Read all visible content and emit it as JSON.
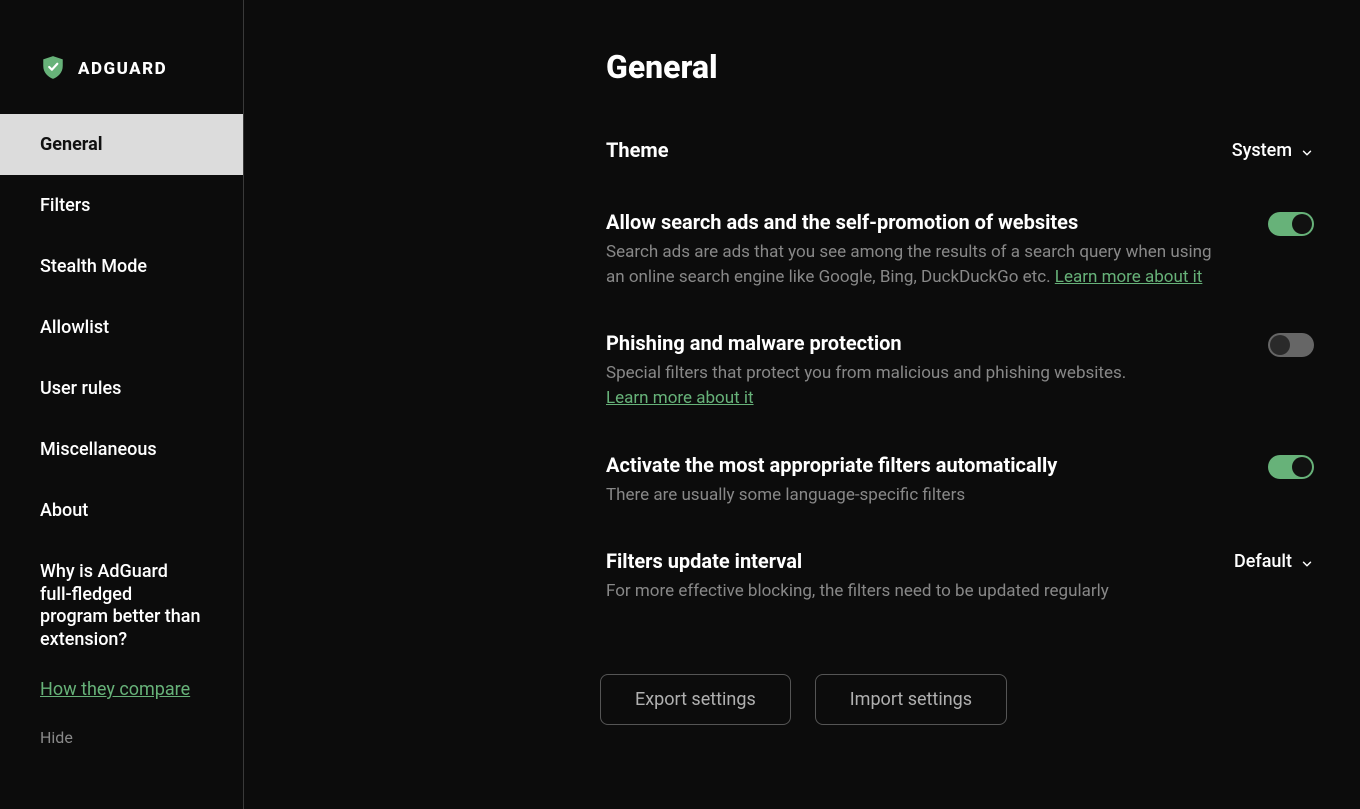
{
  "brand": {
    "name": "ADGUARD"
  },
  "sidebar": {
    "items": [
      {
        "label": "General",
        "active": true
      },
      {
        "label": "Filters"
      },
      {
        "label": "Stealth Mode"
      },
      {
        "label": "Allowlist"
      },
      {
        "label": "User rules"
      },
      {
        "label": "Miscellaneous"
      },
      {
        "label": "About"
      }
    ],
    "promo": {
      "title": "Why is AdGuard full-fledged program better than extension?",
      "link": "How they compare",
      "hide": "Hide"
    }
  },
  "page": {
    "title": "General",
    "theme": {
      "label": "Theme",
      "value": "System"
    },
    "search_ads": {
      "title": "Allow search ads and the self-promotion of websites",
      "desc": "Search ads are ads that you see among the results of a search query when using an online search engine like Google, Bing, DuckDuckGo etc. ",
      "learn": "Learn more about it",
      "on": true
    },
    "phishing": {
      "title": "Phishing and malware protection",
      "desc": "Special filters that protect you from malicious and phishing websites.",
      "learn": "Learn more about it",
      "on": false
    },
    "autofilters": {
      "title": "Activate the most appropriate filters automatically",
      "desc": "There are usually some language-specific filters",
      "on": true
    },
    "update_interval": {
      "title": "Filters update interval",
      "desc": "For more effective blocking, the filters need to be updated regularly",
      "value": "Default"
    },
    "buttons": {
      "export": "Export settings",
      "import": "Import settings"
    }
  }
}
